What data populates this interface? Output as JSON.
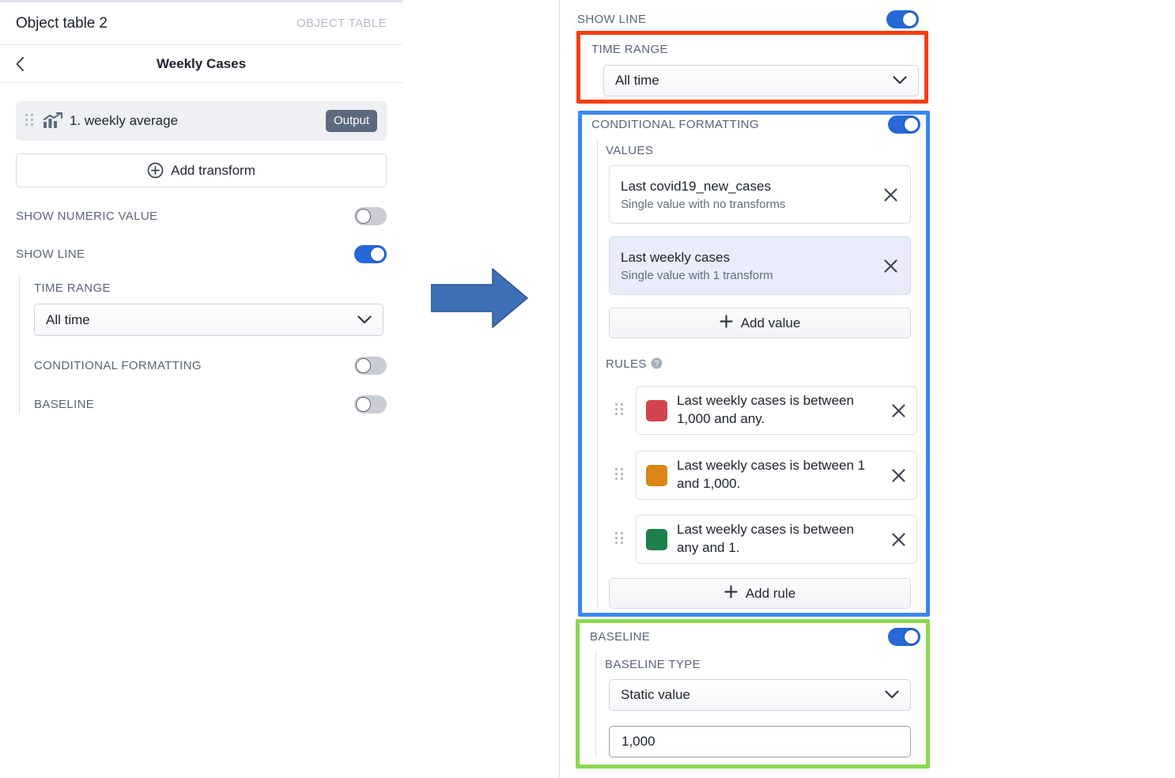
{
  "left_panel": {
    "header": {
      "title": "Object table 2",
      "kind": "OBJECT TABLE"
    },
    "sub_header": {
      "back_label": "‹",
      "title": "Weekly Cases"
    },
    "transform_item": {
      "label": "1. weekly average",
      "badge": "Output",
      "icon": "chart-line-up-icon"
    },
    "add_transform_label": "Add transform",
    "toggles": [
      {
        "label": "SHOW NUMERIC VALUE",
        "state": "off"
      },
      {
        "label": "SHOW LINE",
        "state": "on"
      }
    ],
    "time_range": {
      "label": "TIME RANGE",
      "value": "All time"
    },
    "sub_toggles": [
      {
        "label": "CONDITIONAL FORMATTING",
        "state": "off"
      },
      {
        "label": "BASELINE",
        "state": "off"
      }
    ]
  },
  "arrow": {
    "name": "right-arrow",
    "color": "#3f6fb5"
  },
  "right_panel": {
    "show_line": {
      "label": "SHOW LINE",
      "state": "on"
    },
    "time_range": {
      "label": "TIME RANGE",
      "value": "All time",
      "highlight_color": "#fa3c10"
    },
    "conditional_formatting": {
      "label": "CONDITIONAL FORMATTING",
      "state": "on",
      "highlight_color": "#3b86f7",
      "values_label": "VALUES",
      "values": [
        {
          "title": "Last covid19_new_cases",
          "subtitle": "Single value with no transforms",
          "selected": false
        },
        {
          "title": "Last weekly cases",
          "subtitle": "Single value with 1 transform",
          "selected": true
        }
      ],
      "add_value_label": "Add value",
      "rules_label": "RULES",
      "rules": [
        {
          "color": "#d24350",
          "text": "Last weekly cases is between 1,000 and any."
        },
        {
          "color": "#d98517",
          "text": "Last weekly cases is between 1 and 1,000."
        },
        {
          "color": "#1d804a",
          "text": "Last weekly cases is between any and 1."
        }
      ],
      "add_rule_label": "Add rule"
    },
    "baseline": {
      "label": "BASELINE",
      "state": "on",
      "highlight_color": "#8bd94f",
      "type_label": "BASELINE TYPE",
      "type_value": "Static value",
      "value": "1,000"
    }
  }
}
